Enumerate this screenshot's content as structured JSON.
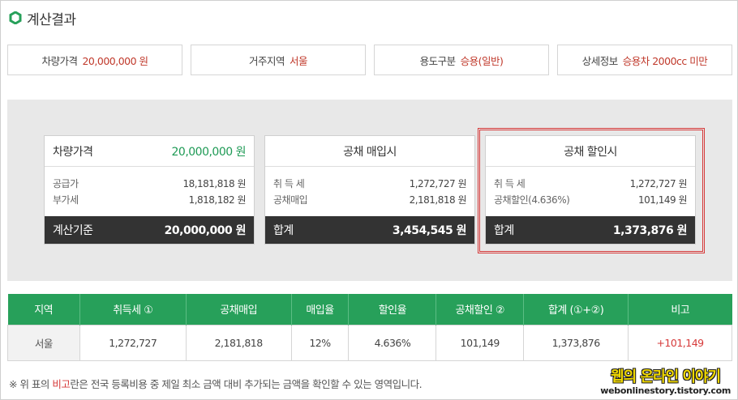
{
  "page_title": "계산결과",
  "info": [
    {
      "key": "차량가격",
      "value": "20,000,000 원"
    },
    {
      "key": "거주지역",
      "value": "서울"
    },
    {
      "key": "용도구분",
      "value": "승용(일반)"
    },
    {
      "key": "상세정보",
      "value": "승용차 2000cc 미만"
    }
  ],
  "cards": {
    "price": {
      "title": "차량가격",
      "title_value": "20,000,000 원",
      "rows": [
        {
          "label": "공급가",
          "value": "18,181,818 원"
        },
        {
          "label": "부가세",
          "value": "1,818,182 원"
        }
      ],
      "footer_label": "계산기준",
      "footer_value": "20,000,000 원"
    },
    "purchase": {
      "title": "공채 매입시",
      "rows": [
        {
          "label": "취 득 세",
          "value": "1,272,727 원"
        },
        {
          "label": "공채매입",
          "value": "2,181,818 원"
        }
      ],
      "footer_label": "합계",
      "footer_value": "3,454,545 원"
    },
    "discount": {
      "title": "공채 할인시",
      "rows": [
        {
          "label": "취 득 세",
          "value": "1,272,727 원"
        },
        {
          "label": "공채할인(4.636%)",
          "value": "101,149 원"
        }
      ],
      "footer_label": "합계",
      "footer_value": "1,373,876 원"
    }
  },
  "table": {
    "headers": [
      "지역",
      "취득세 ①",
      "공채매입",
      "매입율",
      "할인율",
      "공채할인 ②",
      "합계 (①+②)",
      "비고"
    ],
    "row": [
      "서울",
      "1,272,727",
      "2,181,818",
      "12%",
      "4.636%",
      "101,149",
      "1,373,876",
      "+101,149"
    ]
  },
  "footnote": {
    "prefix": "※ 위 표의 ",
    "highlight": "비고",
    "suffix": "란은 전국 등록비용 중 제일 최소 금액 대비 추가되는 금액을 확인할 수 있는 영역입니다."
  },
  "watermark": {
    "main": "웹의 온라인 이야기",
    "sub": "webonlinestory.tistory.com"
  },
  "colors": {
    "accent_green": "#27a05a",
    "value_red": "#c0392b",
    "footer_dark": "#333333",
    "highlight_border": "#d63a3a"
  }
}
